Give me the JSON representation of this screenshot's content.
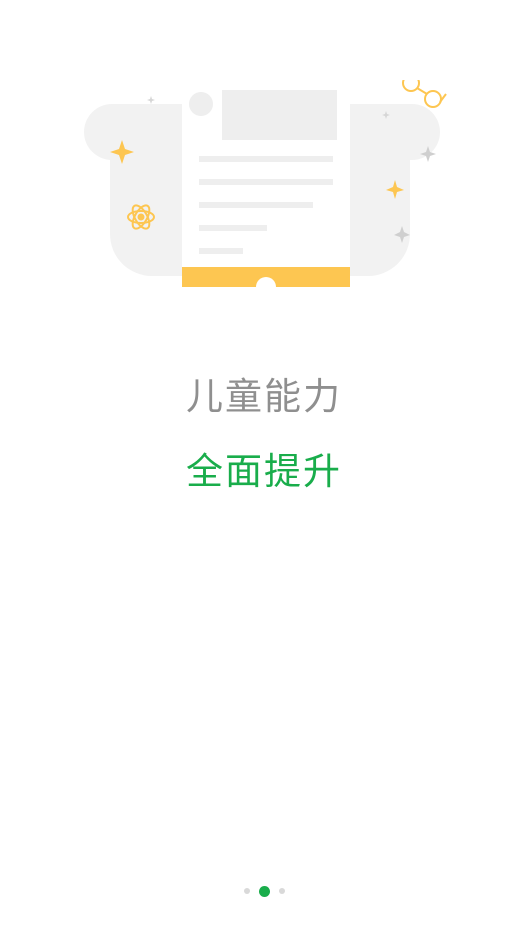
{
  "intro": {
    "title": "儿童能力",
    "subtitle": "全面提升"
  },
  "pager": {
    "page_count": 3,
    "active_index": 1
  },
  "colors": {
    "accent_green": "#19ad4b",
    "title_gray": "#8f8f8f",
    "illustration_yellow": "#fdc651",
    "illustration_gray": "#f2f2f2"
  },
  "icons": [
    "document-illustration",
    "sparkle-icon",
    "atom-icon",
    "glasses-icon"
  ]
}
